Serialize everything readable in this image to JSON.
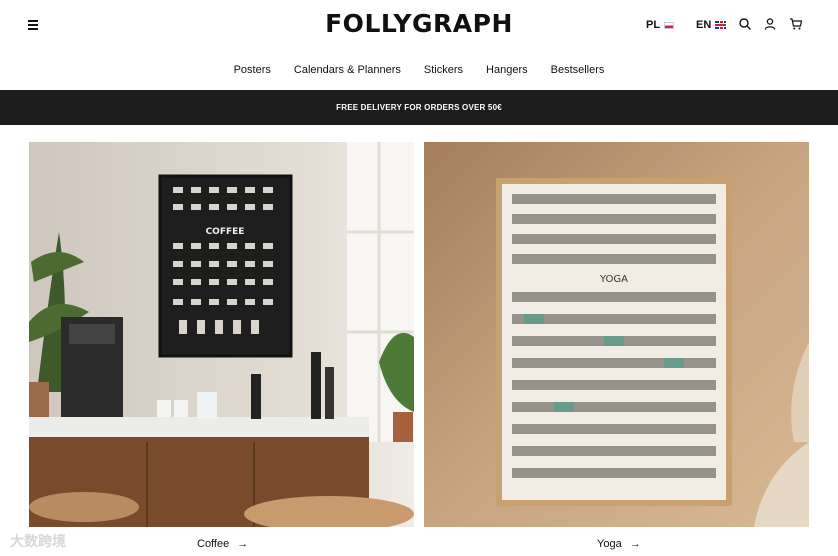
{
  "header": {
    "logo": "FOLLYGRAPH",
    "lang_pl": "PL",
    "lang_en": "EN",
    "icons": [
      "menu-icon",
      "search-icon",
      "user-icon",
      "cart-icon"
    ]
  },
  "nav": {
    "items": [
      "Posters",
      "Calendars & Planners",
      "Stickers",
      "Hangers",
      "Bestsellers"
    ]
  },
  "banner": {
    "text": "FREE DELIVERY FOR ORDERS OVER 50€"
  },
  "products": [
    {
      "label": "Coffee",
      "poster_title": "COFFEE"
    },
    {
      "label": "Yoga",
      "poster_title": "YOGA"
    }
  ],
  "watermark": {
    "text": "大数跨境"
  }
}
